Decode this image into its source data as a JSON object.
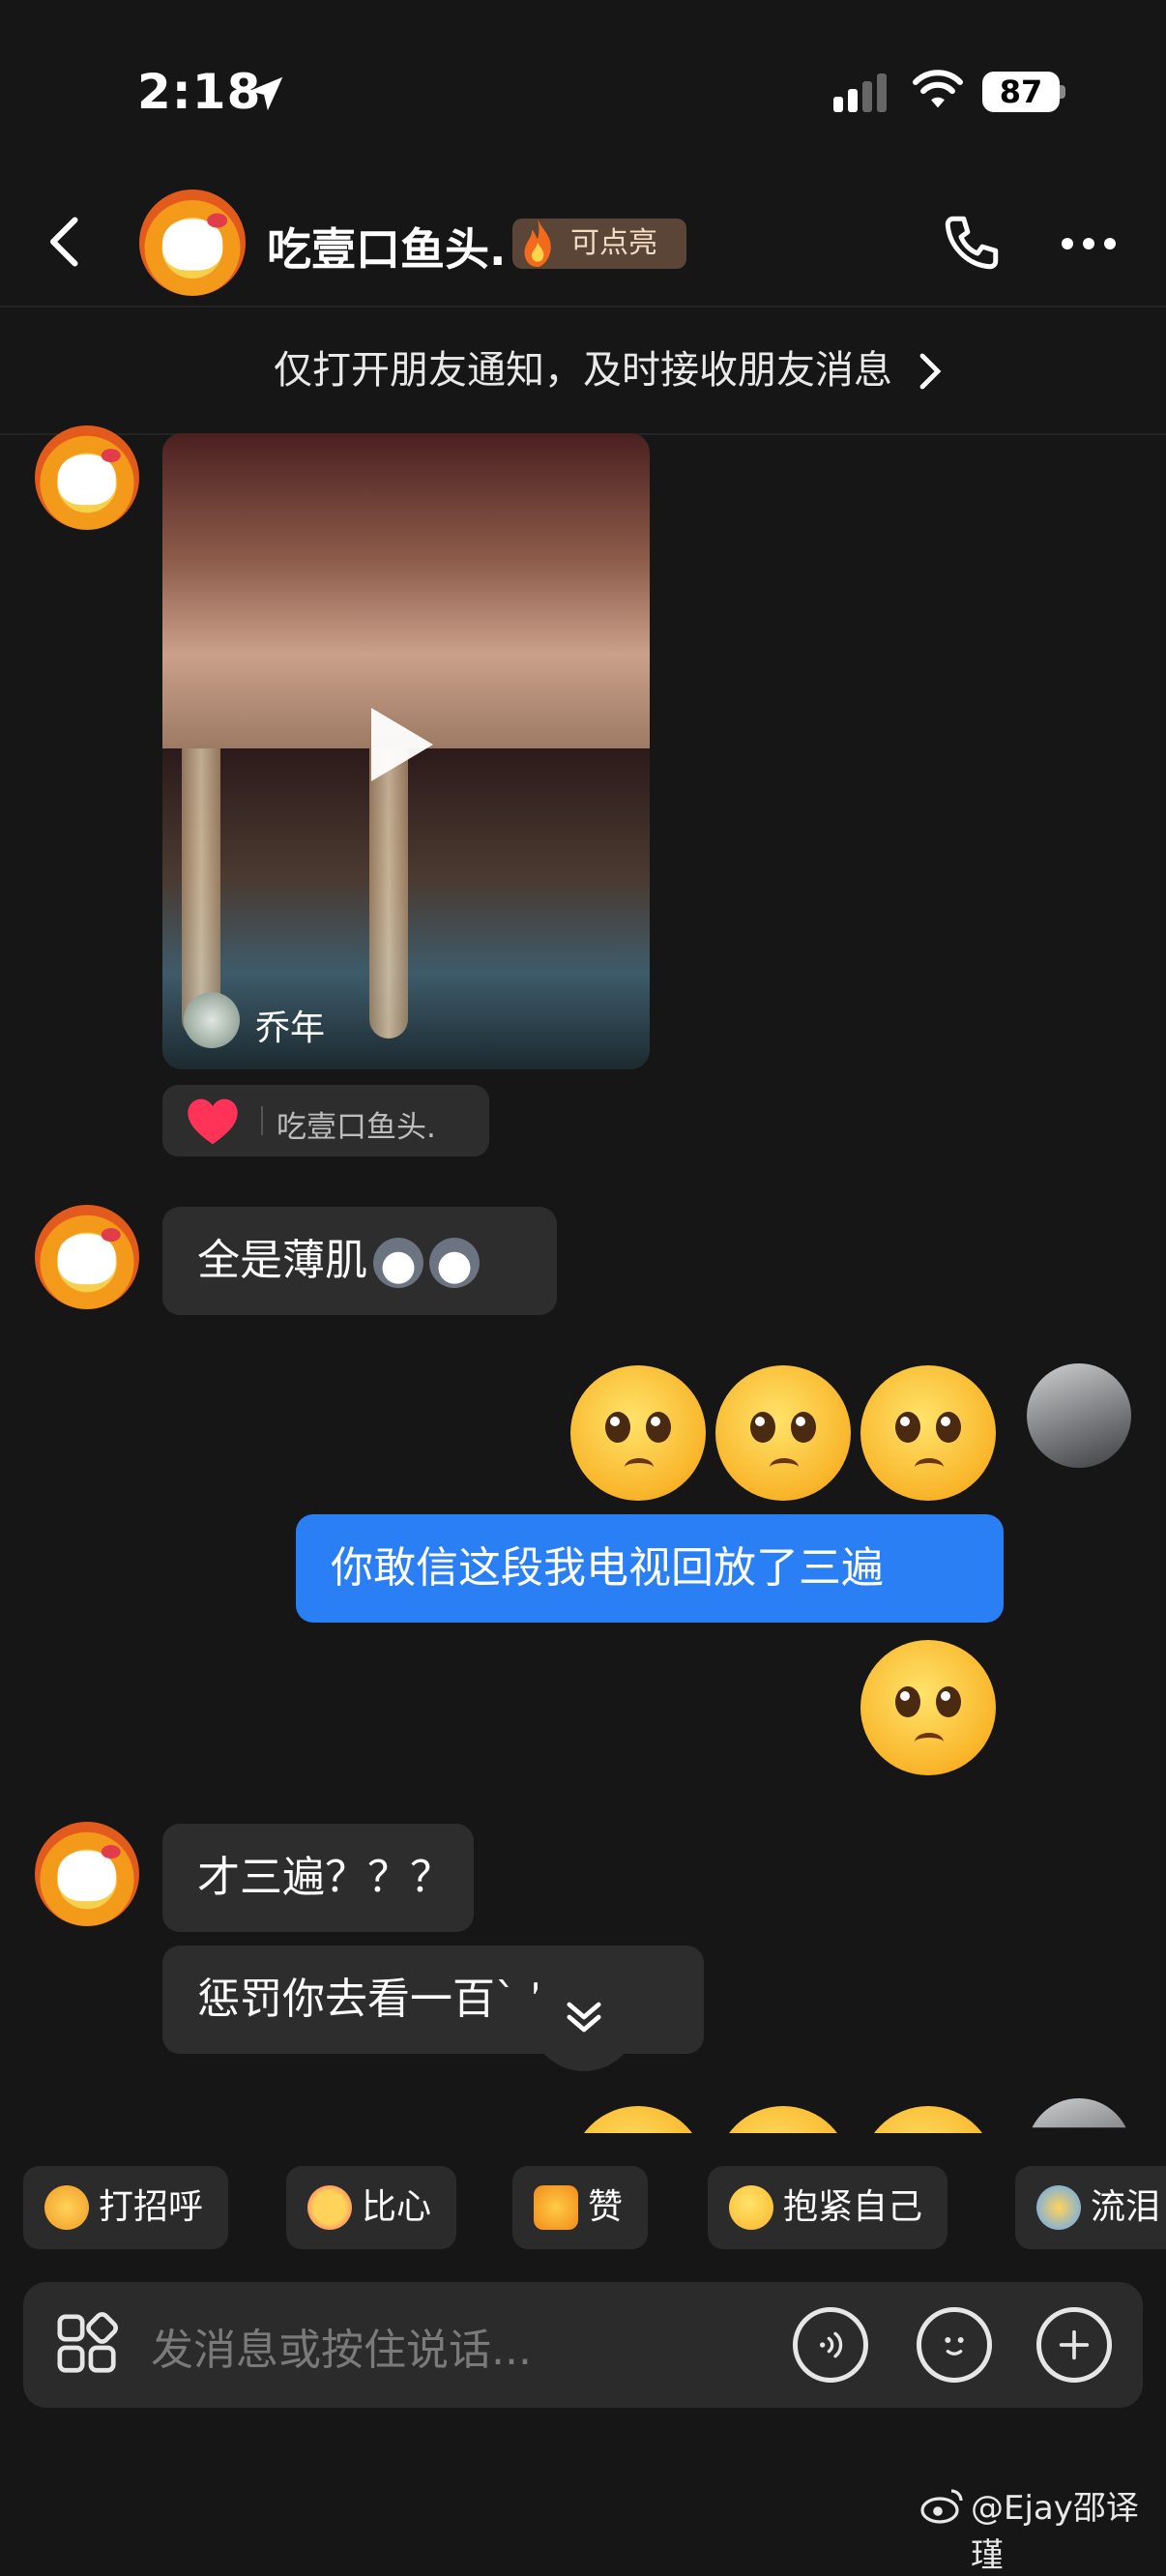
{
  "status_bar": {
    "time": "2:18",
    "battery": "87"
  },
  "header": {
    "title": "吃壹口鱼头.",
    "badge": "可点亮"
  },
  "notice": {
    "text": "仅打开朋友通知，及时接收朋友消息"
  },
  "video_card": {
    "author": "乔年"
  },
  "reaction": {
    "name": "吃壹口鱼头."
  },
  "messages": {
    "m1": "全是薄肌",
    "m2": "你敢信这段我电视回放了三遍",
    "m3": "才三遍？？？",
    "m4": "惩罚你去看一百` '！"
  },
  "quick_replies": [
    "打招呼",
    "比心",
    "赞",
    "抱紧自己",
    "流泪"
  ],
  "input": {
    "placeholder": "发消息或按住说话..."
  },
  "watermark": "@Ejay邵译瑾",
  "colors": {
    "background": "#161616",
    "bubble_other": "#2d2d2d",
    "bubble_me": "#2a7ff5",
    "badge_bg": "#5a4537"
  },
  "icons": [
    "location-arrow-icon",
    "signal-icon",
    "wifi-icon",
    "battery-icon",
    "back-icon",
    "fire-icon",
    "phone-icon",
    "more-icon",
    "chevron-right-icon",
    "play-icon",
    "heart-icon",
    "scroll-down-icon",
    "apps-icon",
    "voice-icon",
    "emoji-icon",
    "plus-icon",
    "weibo-icon"
  ]
}
